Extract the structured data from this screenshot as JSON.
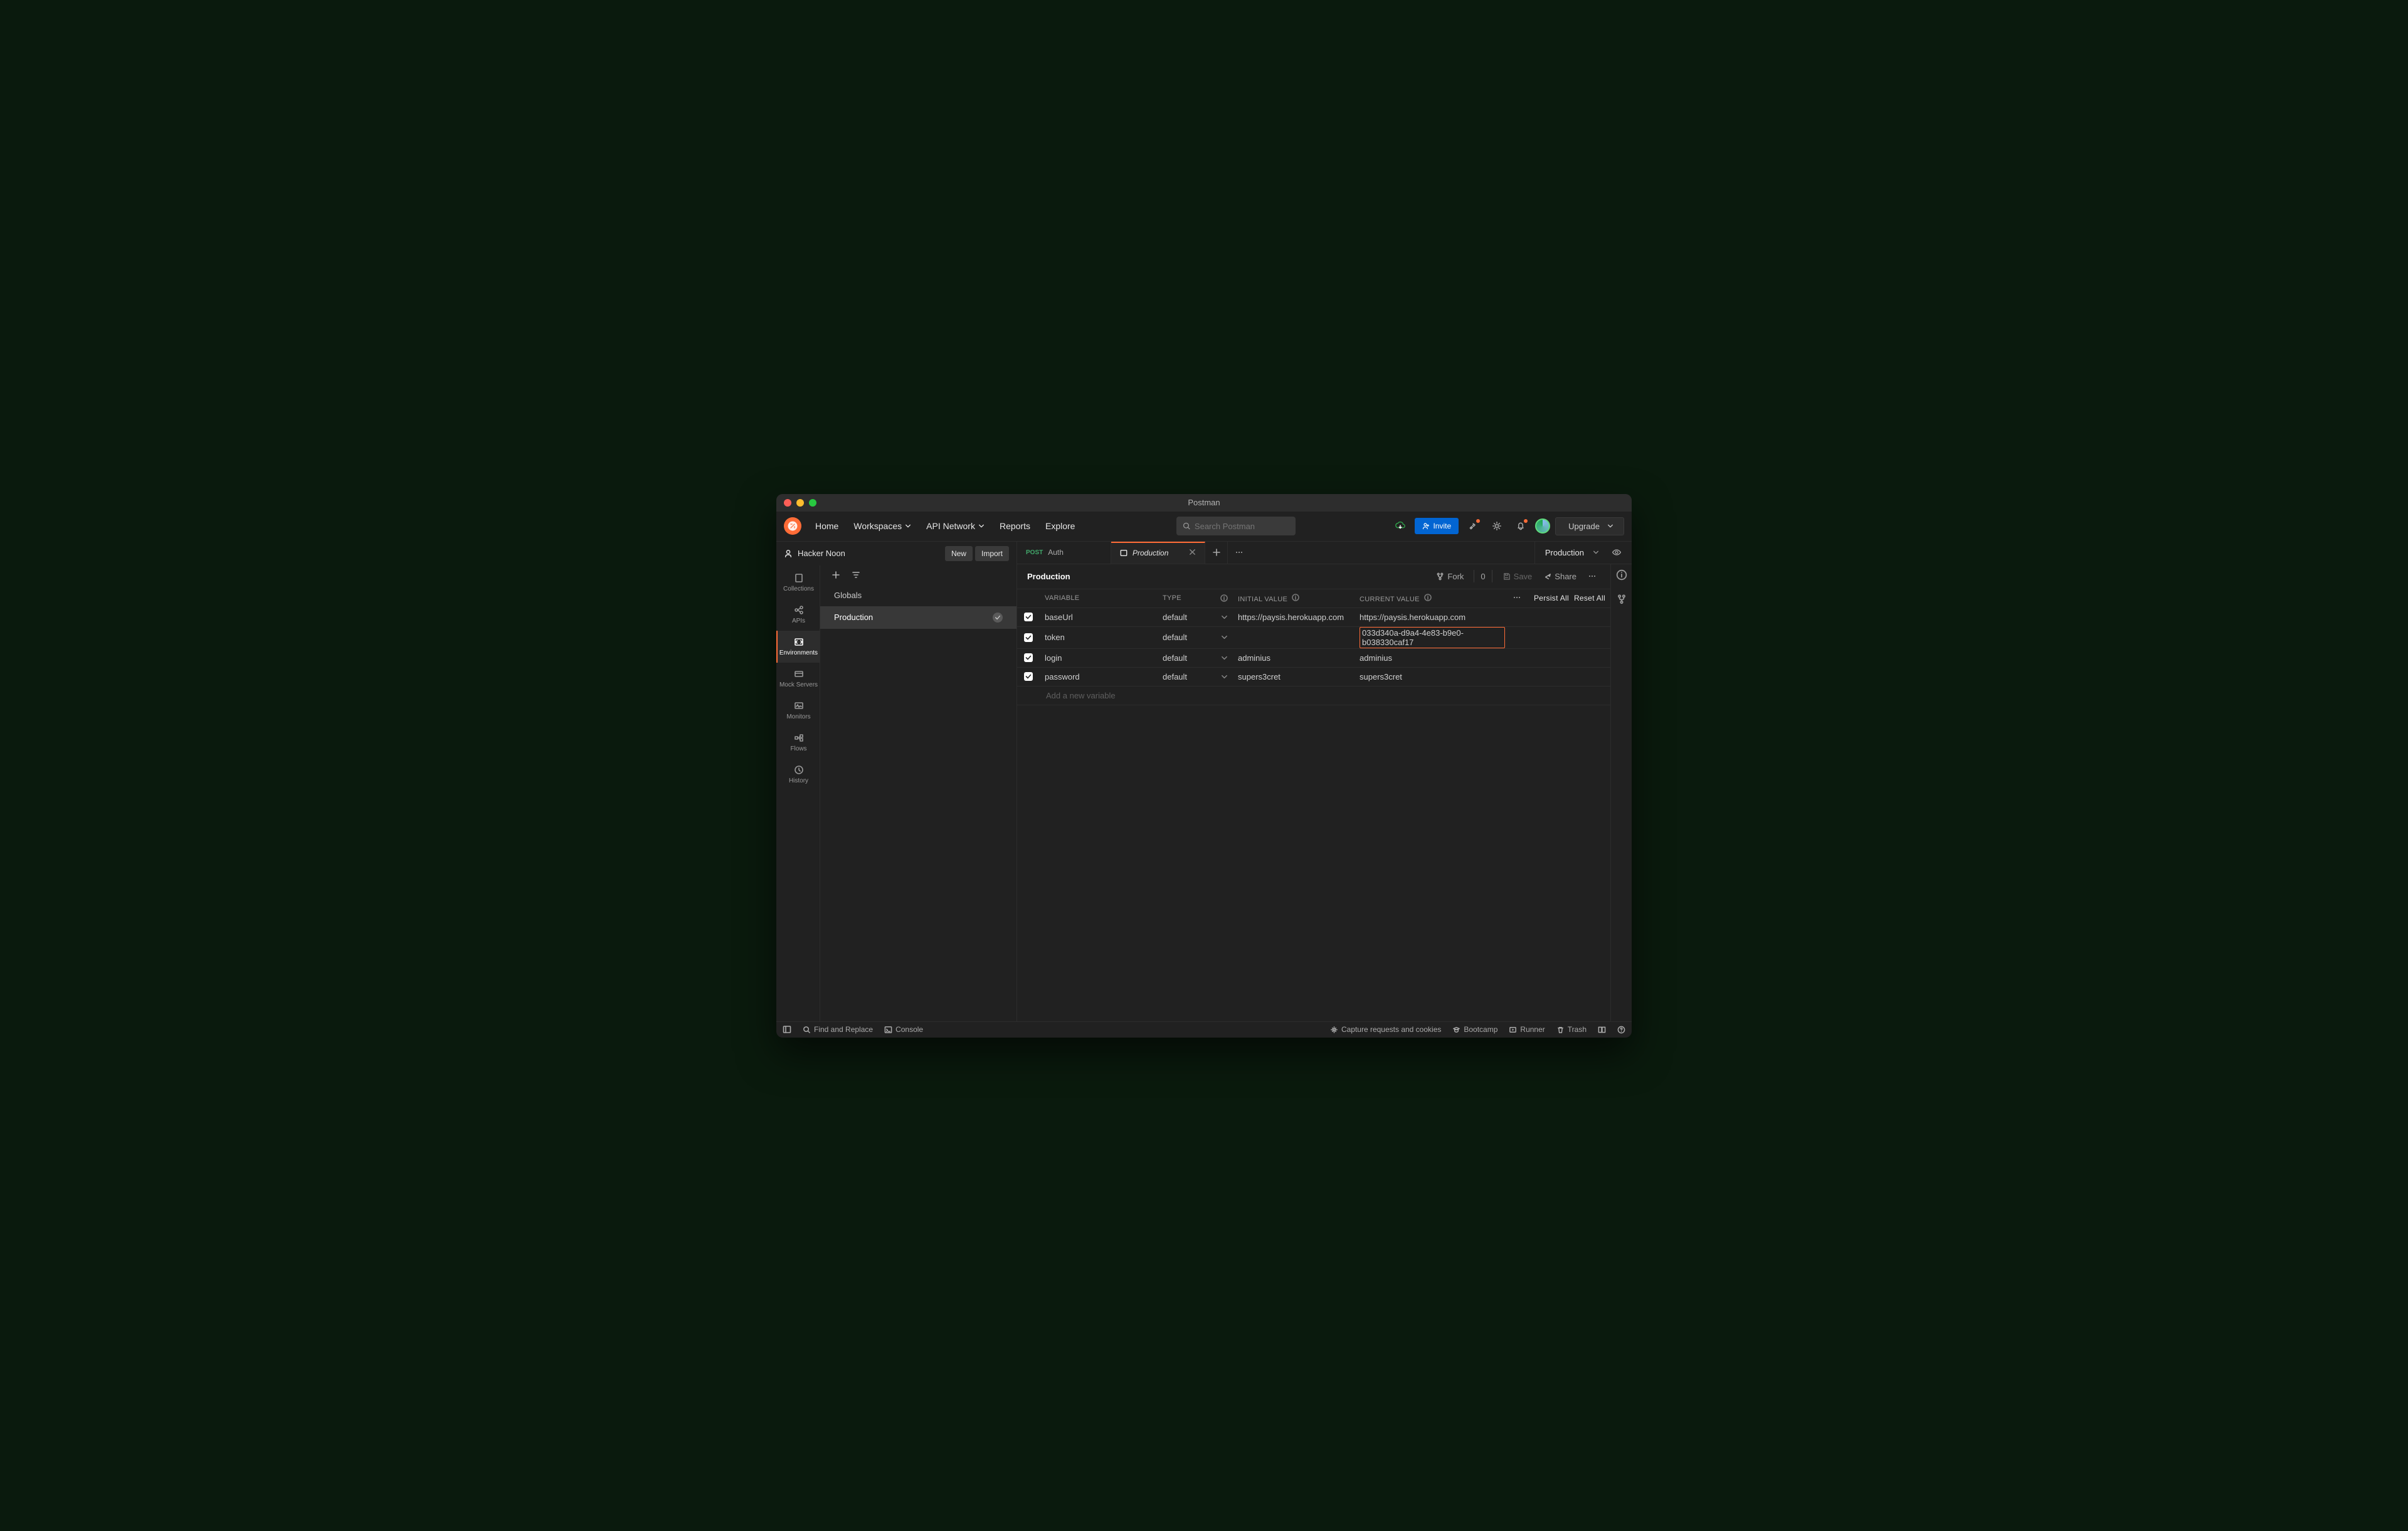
{
  "window": {
    "title": "Postman"
  },
  "topnav": {
    "home": "Home",
    "workspaces": "Workspaces",
    "api_network": "API Network",
    "reports": "Reports",
    "explore": "Explore",
    "search_placeholder": "Search Postman",
    "invite": "Invite",
    "upgrade": "Upgrade"
  },
  "workspace": {
    "name": "Hacker Noon",
    "new": "New",
    "import": "Import"
  },
  "vnav": {
    "collections": "Collections",
    "apis": "APIs",
    "environments": "Environments",
    "mock": "Mock Servers",
    "monitors": "Monitors",
    "flows": "Flows",
    "history": "History"
  },
  "envlist": {
    "globals": "Globals",
    "production": "Production"
  },
  "tabs": {
    "auth_method": "POST",
    "auth_label": "Auth",
    "production_label": "Production"
  },
  "env_selector": {
    "label": "Production"
  },
  "header": {
    "title": "Production",
    "fork": "Fork",
    "fork_count": "0",
    "save": "Save",
    "share": "Share"
  },
  "table": {
    "col_variable": "VARIABLE",
    "col_type": "TYPE",
    "col_initial": "INITIAL VALUE",
    "col_current": "CURRENT VALUE",
    "persist_all": "Persist All",
    "reset_all": "Reset All",
    "placeholder": "Add a new variable",
    "rows": [
      {
        "variable": "baseUrl",
        "type": "default",
        "initial": "https://paysis.herokuapp.com",
        "current": "https://paysis.herokuapp.com",
        "highlight": false
      },
      {
        "variable": "token",
        "type": "default",
        "initial": "",
        "current": "033d340a-d9a4-4e83-b9e0-b038330caf17",
        "highlight": true
      },
      {
        "variable": "login",
        "type": "default",
        "initial": "adminius",
        "current": "adminius",
        "highlight": false
      },
      {
        "variable": "password",
        "type": "default",
        "initial": "supers3cret",
        "current": "supers3cret",
        "highlight": false
      }
    ]
  },
  "statusbar": {
    "find": "Find and Replace",
    "console": "Console",
    "capture": "Capture requests and cookies",
    "bootcamp": "Bootcamp",
    "runner": "Runner",
    "trash": "Trash"
  }
}
